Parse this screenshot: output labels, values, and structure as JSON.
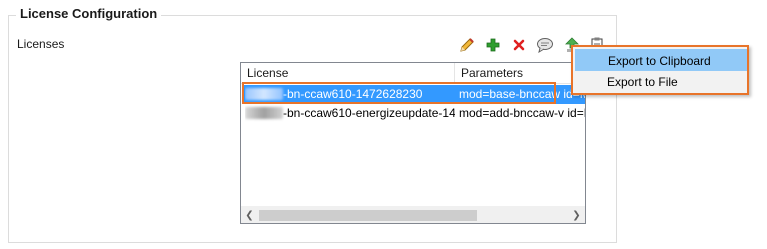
{
  "group": {
    "title": "License Configuration"
  },
  "licenses_label": "Licenses",
  "toolbar": {
    "icons": [
      "pencil-icon",
      "plus-icon",
      "x-icon",
      "comment-icon",
      "upload-icon",
      "clipboard-icon"
    ],
    "colors": {
      "plus": "#2e9e2e",
      "delete": "#e02020",
      "pencil": "#e8a317"
    }
  },
  "table": {
    "columns": [
      "License",
      "Parameters"
    ],
    "rows": [
      {
        "license": "-bn-ccaw610-1472628230",
        "params": "mod=base-bnccaw id=M"
      },
      {
        "license": "-bn-ccaw610-energizeupdate-14...",
        "params": "mod=add-bnccaw-v id=M/"
      }
    ],
    "selected_row": 0
  },
  "menu": {
    "items": [
      "Export to Clipboard",
      "Export to File"
    ]
  },
  "colors": {
    "selection": "#3399ff",
    "highlight": "#e8742a",
    "menu_hover": "#91c9f7"
  }
}
